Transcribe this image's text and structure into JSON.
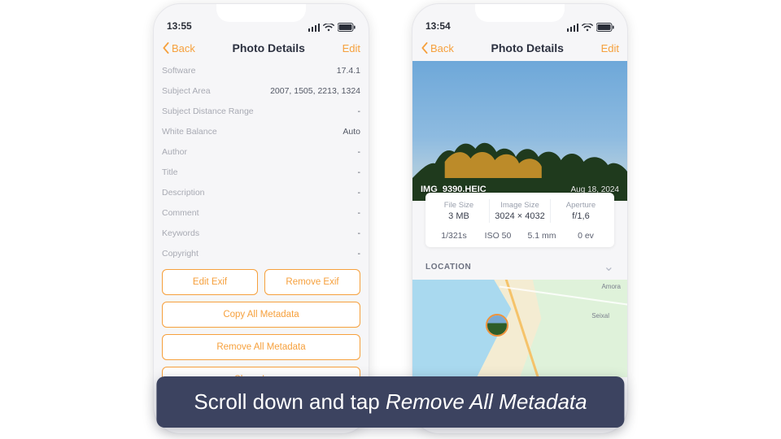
{
  "status": {
    "time_left": "13:55",
    "time_right": "13:54"
  },
  "nav": {
    "back": "Back",
    "title": "Photo Details",
    "edit": "Edit"
  },
  "left": {
    "rows": [
      {
        "label": "Software",
        "value": "17.4.1"
      },
      {
        "label": "Subject Area",
        "value": "2007, 1505, 2213, 1324"
      },
      {
        "label": "Subject Distance Range",
        "value": "-"
      },
      {
        "label": "White Balance",
        "value": "Auto"
      },
      {
        "label": "Author",
        "value": "-"
      },
      {
        "label": "Title",
        "value": "-"
      },
      {
        "label": "Description",
        "value": "-"
      },
      {
        "label": "Comment",
        "value": "-"
      },
      {
        "label": "Keywords",
        "value": "-"
      },
      {
        "label": "Copyright",
        "value": "-"
      }
    ],
    "buttons": {
      "edit_exif": "Edit Exif",
      "remove_exif": "Remove Exif",
      "copy_all": "Copy All Metadata",
      "remove_all": "Remove All Metadata",
      "share": "Share Image"
    }
  },
  "right": {
    "photo": {
      "filename": "IMG_9390.HEIC",
      "date": "Aug 18, 2024"
    },
    "card": {
      "file_size_label": "File Size",
      "file_size": "3 MB",
      "image_size_label": "Image Size",
      "image_size": "3024 × 4032",
      "aperture_label": "Aperture",
      "aperture": "f/1,6",
      "shutter": "1/321s",
      "iso": "ISO 50",
      "focal": "5.1 mm",
      "ev": "0 ev"
    },
    "location": {
      "title": "LOCATION",
      "town1": "Amora",
      "town2": "Seixal"
    }
  },
  "caption": {
    "prefix": "Scroll down and tap ",
    "em": "Remove All Metadata"
  }
}
